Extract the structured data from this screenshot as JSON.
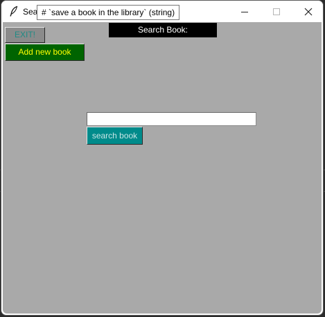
{
  "window": {
    "title": "Search Book",
    "tooltip": "# `save a book in the library` (string)",
    "controls": {
      "minimize": "minimize-icon",
      "maximize": "maximize-icon",
      "close": "close-icon"
    }
  },
  "header": {
    "label": "Search Book:"
  },
  "toolbar": {
    "exit_label": "EXIT!",
    "add_label": "Add new book"
  },
  "search": {
    "value": "",
    "placeholder": "",
    "button_label": "search book"
  },
  "colors": {
    "client_background": "#a9a9a9",
    "header_background": "#000000",
    "header_text": "#ffffff",
    "exit_background": "#8b8b8b",
    "exit_text": "#1f8b85",
    "add_background": "#006400",
    "add_text": "#ffff00",
    "search_button_background": "#008b8b",
    "search_button_text": "#c9e6e6"
  }
}
